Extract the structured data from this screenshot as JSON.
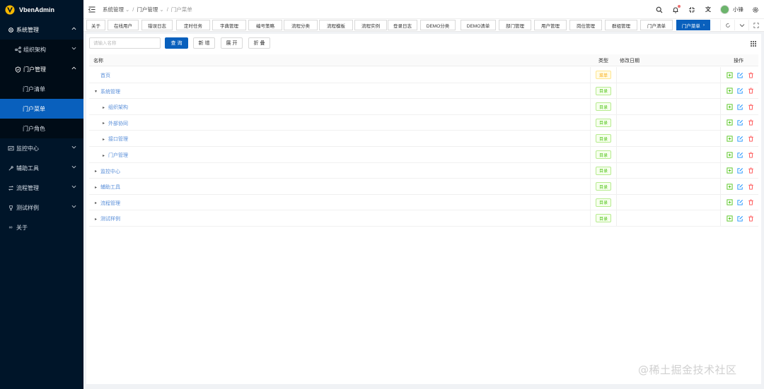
{
  "app": {
    "title": "VbenAdmin"
  },
  "sidebar": {
    "items": [
      {
        "label": "系统管理",
        "icon": "gear-icon"
      },
      {
        "label": "组织架构",
        "icon": "org-icon"
      },
      {
        "label": "门户管理",
        "icon": "shield-icon"
      },
      {
        "label": "门户清单"
      },
      {
        "label": "门户菜单"
      },
      {
        "label": "门户角色"
      },
      {
        "label": "监控中心",
        "icon": "monitor-icon"
      },
      {
        "label": "辅助工具",
        "icon": "tool-icon"
      },
      {
        "label": "流程管理",
        "icon": "flow-icon"
      },
      {
        "label": "测试样例",
        "icon": "trophy-icon"
      },
      {
        "label": "关于",
        "icon": "infinity-icon"
      }
    ]
  },
  "breadcrumb": [
    "系统管理",
    "门户管理",
    "门户菜单"
  ],
  "header": {
    "username": "小锋"
  },
  "tabs": [
    "关于",
    "在线用户",
    "错误日志",
    "定时任务",
    "字典管理",
    "编号策略",
    "流程分类",
    "流程模板",
    "流程实例",
    "登录日志",
    "DEMO分类",
    "DEMO清单",
    "部门管理",
    "用户管理",
    "岗位管理",
    "群组管理",
    "门户清单",
    "门户菜单"
  ],
  "toolbar": {
    "search_placeholder": "请输入名称",
    "query": "查 询",
    "add": "新 增",
    "expand": "展 开",
    "collapse": "折 叠"
  },
  "table": {
    "headers": {
      "name": "名称",
      "type": "类型",
      "date": "修改日期",
      "ops": "操作"
    },
    "rows": [
      {
        "name": "首页",
        "type": "菜单",
        "level": 0,
        "arrow": ""
      },
      {
        "name": "系统管理",
        "type": "目录",
        "level": 0,
        "arrow": "down"
      },
      {
        "name": "组织架构",
        "type": "目录",
        "level": 1,
        "arrow": "right"
      },
      {
        "name": "外部协同",
        "type": "目录",
        "level": 1,
        "arrow": "right"
      },
      {
        "name": "接口管理",
        "type": "目录",
        "level": 1,
        "arrow": "right"
      },
      {
        "name": "门户管理",
        "type": "目录",
        "level": 1,
        "arrow": "right"
      },
      {
        "name": "监控中心",
        "type": "目录",
        "level": 0,
        "arrow": "right"
      },
      {
        "name": "辅助工具",
        "type": "目录",
        "level": 0,
        "arrow": "right"
      },
      {
        "name": "流程管理",
        "type": "目录",
        "level": 0,
        "arrow": "right"
      },
      {
        "name": "测试样例",
        "type": "目录",
        "level": 0,
        "arrow": "right"
      }
    ]
  },
  "watermark": "@稀土掘金技术社区",
  "colors": {
    "primary": "#0960bd",
    "sidebar": "#001529",
    "tag_green": "#52c41a",
    "tag_yellow": "#faad14"
  }
}
